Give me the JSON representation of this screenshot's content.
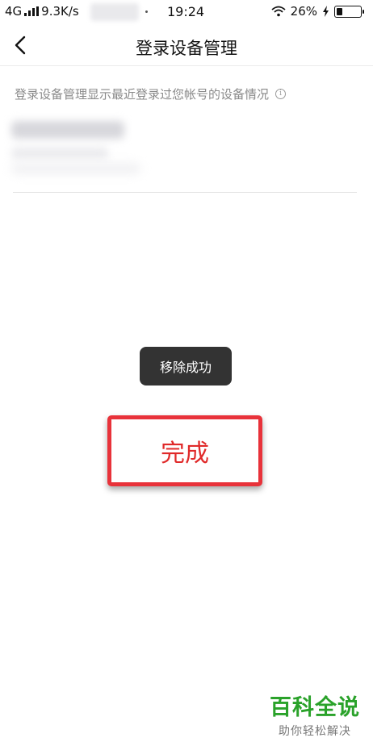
{
  "status_bar": {
    "network": "4G",
    "speed": "9.3K/s",
    "time": "19:24",
    "battery_percent": "26%",
    "battery_level": 0.26,
    "icons": [
      "signal-icon",
      "wifi-icon",
      "charging-icon",
      "battery-icon"
    ]
  },
  "nav": {
    "title": "登录设备管理",
    "back_icon": "chevron-left-icon"
  },
  "description": "登录设备管理显示最近登录过您帐号的设备情况",
  "info_icon": "info-icon",
  "toast": "移除成功",
  "annotation": {
    "label": "完成",
    "border_color": "#e8323a",
    "text_color": "#e02a2a"
  },
  "watermark": {
    "title": "百科全说",
    "subtitle": "助你轻松解决",
    "color": "#2aa22a"
  }
}
